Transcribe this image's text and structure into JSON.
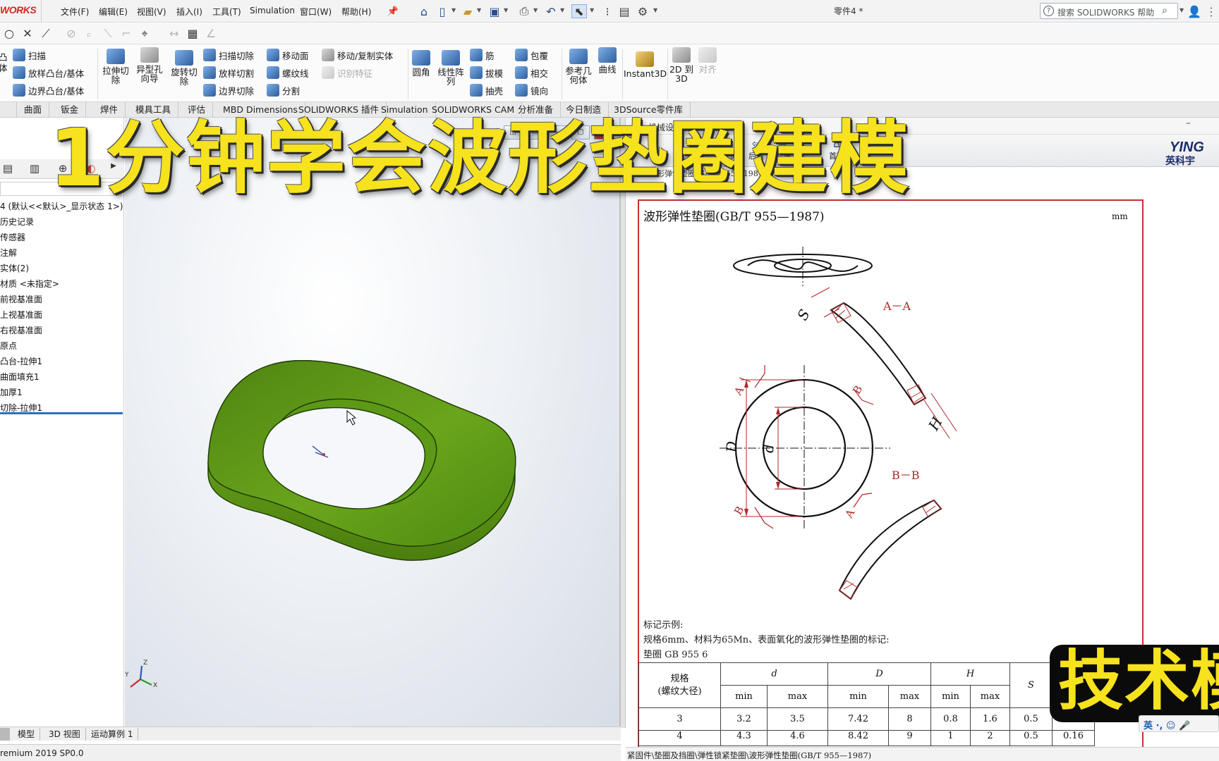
{
  "app": {
    "logo": "WORKS",
    "doc_title": "零件4 *",
    "help_search_placeholder": "搜索 SOLIDWORKS 帮助",
    "version": "remium 2019 SP0.0"
  },
  "menu": [
    "文件(F)",
    "编辑(E)",
    "视图(V)",
    "插入(I)",
    "工具(T)",
    "Simulation",
    "窗口(W)",
    "帮助(H)"
  ],
  "command_manager": {
    "small_left": [
      {
        "label": "扫描",
        "name": "sweep"
      },
      {
        "label": "放样凸台/基体",
        "name": "loft-boss"
      },
      {
        "label": "边界凸台/基体",
        "name": "boundary-boss"
      }
    ],
    "big": [
      {
        "label": "拉伸切\n除",
        "name": "extruded-cut"
      },
      {
        "label": "异型孔\n向导",
        "name": "hole-wizard"
      },
      {
        "label": "旋转切\n除",
        "name": "revolved-cut"
      }
    ],
    "small_mid1": [
      {
        "label": "扫描切除",
        "name": "swept-cut"
      },
      {
        "label": "放样切割",
        "name": "lofted-cut"
      },
      {
        "label": "边界切除",
        "name": "boundary-cut"
      }
    ],
    "small_mid2": [
      {
        "label": "移动面",
        "name": "move-face"
      },
      {
        "label": "螺纹线",
        "name": "thread"
      },
      {
        "label": "分割",
        "name": "split"
      }
    ],
    "small_mid3": [
      {
        "label": "移动/复制实体",
        "name": "move-copy-body"
      },
      {
        "label": "识别特征",
        "name": "feature-recognition",
        "disabled": true
      }
    ],
    "big2": [
      {
        "label": "圆角",
        "name": "fillet"
      },
      {
        "label": "线性阵\n列",
        "name": "linear-pattern"
      }
    ],
    "small_mid4": [
      {
        "label": "筋",
        "name": "rib"
      },
      {
        "label": "拔模",
        "name": "draft"
      },
      {
        "label": "抽壳",
        "name": "shell"
      }
    ],
    "small_mid5": [
      {
        "label": "包覆",
        "name": "wrap"
      },
      {
        "label": "相交",
        "name": "intersect"
      },
      {
        "label": "镜向",
        "name": "mirror"
      }
    ],
    "big3": [
      {
        "label": "参考几\n何体",
        "name": "reference-geometry"
      },
      {
        "label": "曲线",
        "name": "curves"
      },
      {
        "label": "Instant3D",
        "name": "instant3d"
      },
      {
        "label": "2D 到\n3D",
        "name": "2d-to-3d"
      },
      {
        "label": "对齐",
        "name": "align",
        "disabled": true
      }
    ]
  },
  "tabs": [
    "曲面",
    "钣金",
    "焊件",
    "模具工具",
    "评估",
    "MBD Dimensions",
    "SOLIDWORKS 插件",
    "Simulation",
    "SOLIDWORKS CAM",
    "分析准备",
    "今日制造",
    "3DSource零件库"
  ],
  "feature_tree": [
    "4  (默认<<默认>_显示状态 1>)",
    "历史记录",
    "传感器",
    "注解",
    "实体(2)",
    "材质 <未指定>",
    "前视基准面",
    "上视基准面",
    "右视基准面",
    "原点",
    "凸台-拉伸1",
    "曲面填充1",
    "加厚1",
    "切除-拉伸1"
  ],
  "model_tabs": [
    "模型",
    "3D 视图",
    "运动算例 1"
  ],
  "handbook": {
    "window_title": "机械设计手册电子版",
    "toolbar": [
      "上页",
      "下页",
      "后退",
      "前进",
      "首页"
    ],
    "path": "波形弹性垫圈(GB/T 955—1987)",
    "page_title": "波形弹性垫圈(GB/T 955—1987)",
    "unit": "mm",
    "section_aa": "A－A",
    "section_bb": "B－B",
    "dim_S": "S",
    "dim_H": "H",
    "dim_D": "D",
    "dim_d": "d",
    "label_A": "A",
    "label_B": "B",
    "mark_label": "标记示例:",
    "mark_desc": "规格6mm、材料为65Mn、表面氧化的波形弹性垫圈的标记:",
    "mark_code": "垫圈      GB 955    6",
    "table": {
      "spec_header": "规格\n(螺纹大径)",
      "col_d": "d",
      "col_D": "D",
      "col_H": "H",
      "col_S": "S",
      "sub": [
        "min",
        "max",
        "min",
        "max",
        "min",
        "max"
      ],
      "rows": [
        [
          "3",
          "3.2",
          "3.5",
          "7.42",
          "8",
          "0.8",
          "1.6",
          "0.5"
        ],
        [
          "4",
          "4.3",
          "4.6",
          "8.42",
          "9",
          "1",
          "2",
          "0.5",
          "0.16"
        ]
      ]
    },
    "status_path": "紧固件\\垫圈及挡圈\\弹性锁紧垫圈\\波形弹性垫圈(GB/T 955—1987)",
    "brand_en": "YING",
    "brand_cn": "英科宇"
  },
  "overlay": {
    "headline": "1分钟学会波形垫圈建模",
    "badge": "技术模",
    "ime": "英 ·, ☺ 🎤"
  },
  "colors": {
    "washer": "#5f9217",
    "headline": "#f6e21d",
    "border_red": "#c8302f",
    "logo_red": "#d7261f"
  }
}
